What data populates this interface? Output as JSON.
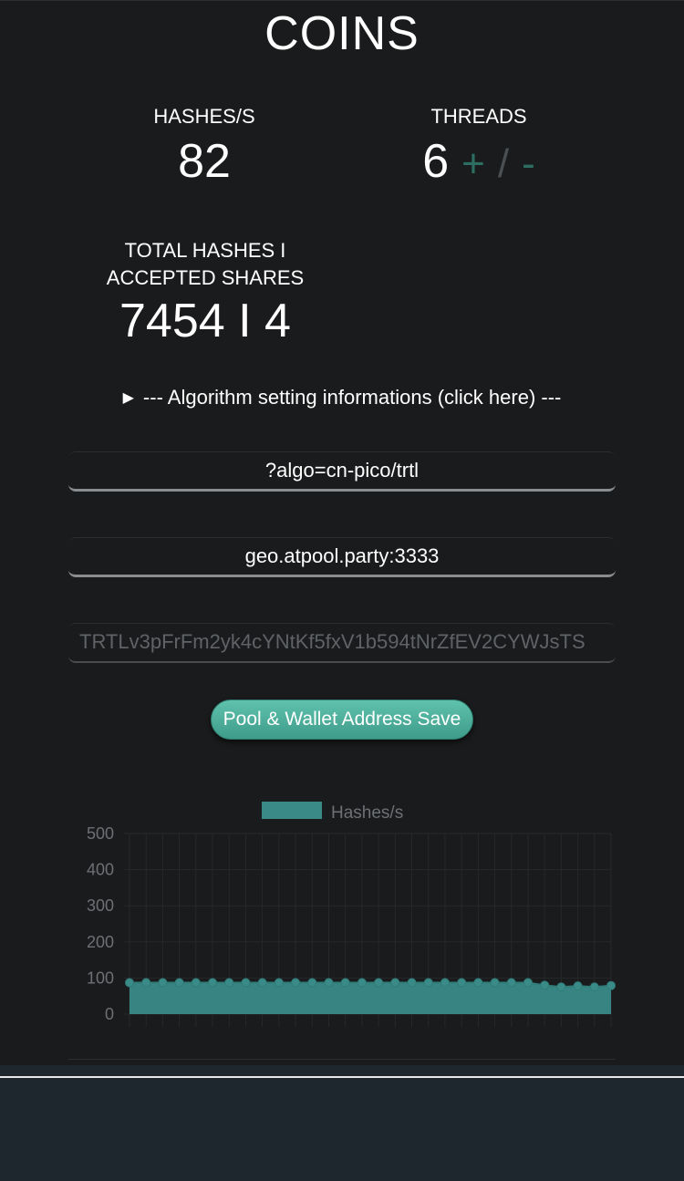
{
  "header": {
    "title": "COINS"
  },
  "stats": {
    "hashes_label": "HASHES/S",
    "hashes_value": "82",
    "threads_label": "THREADS",
    "threads_value": "6",
    "threads_plus": "+",
    "threads_slash": "/",
    "threads_minus": "-",
    "total_label_line1": "TOTAL HASHES I",
    "total_label_line2": "ACCEPTED SHARES",
    "total_value": "7454 I 4"
  },
  "algo_toggle": {
    "arrow": "▶",
    "text": "--- Algorithm setting informations (click here) ---"
  },
  "fields": {
    "algo": "?algo=cn-pico/trtl",
    "pool": "geo.atpool.party:3333",
    "wallet": "TRTLv3pFrFm2yk4cYNtKf5fxV1b594tNrZfEV2CYWJsTS"
  },
  "save_button": {
    "label": "Pool & Wallet Address Save"
  },
  "colors": {
    "accent": "#3e9c8a",
    "series_fill": "#3a8a88",
    "threads_controls": "#2c6e62"
  },
  "chart_data": {
    "type": "area",
    "legend": [
      "Hashes/s"
    ],
    "legend_position": "top-center",
    "y_ticks": [
      "500",
      "400",
      "300",
      "200",
      "100",
      "0"
    ],
    "ylim": [
      0,
      500
    ],
    "grid": true,
    "series": [
      {
        "name": "Hashes/s",
        "values": [
          87,
          87,
          87,
          87,
          87,
          87,
          87,
          87,
          87,
          87,
          87,
          87,
          87,
          87,
          87,
          87,
          87,
          87,
          87,
          87,
          87,
          87,
          87,
          87,
          87,
          80,
          75,
          78,
          75,
          79
        ]
      }
    ]
  }
}
